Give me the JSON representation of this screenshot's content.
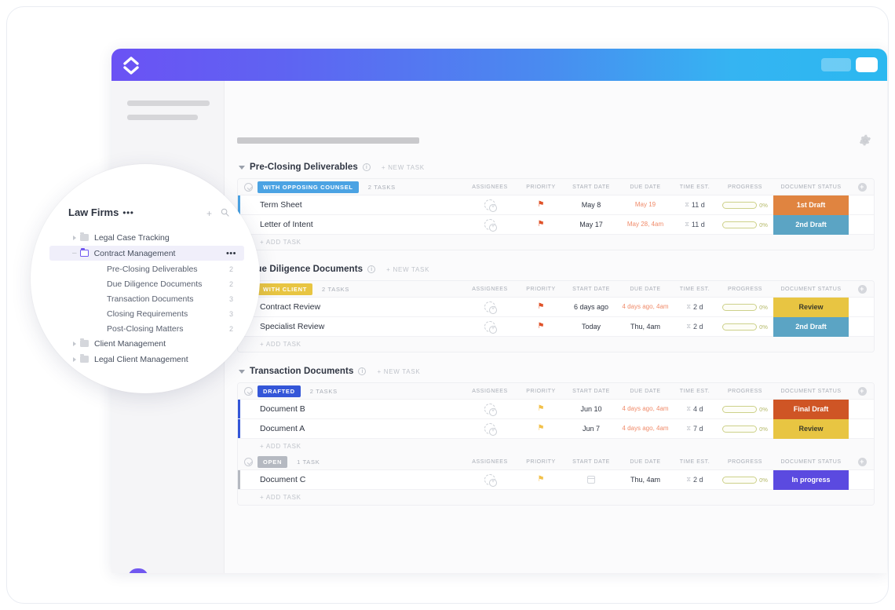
{
  "app": {
    "logo_icon": "clickup-logo-icon",
    "topbar_gradient_from": "#6b52f4",
    "topbar_gradient_to": "#2bb8f0",
    "gear_icon": "gear-icon",
    "chat_icon": "chat-bubble-icon",
    "chat_dots": "•••"
  },
  "columns": {
    "assignees": "ASSIGNEES",
    "priority": "PRIORITY",
    "start_date": "START DATE",
    "due_date": "DUE DATE",
    "time_est": "TIME EST.",
    "progress": "PROGRESS",
    "document_status": "DOCUMENT STATUS",
    "add_column": "+"
  },
  "labels": {
    "new_task": "+ NEW TASK",
    "add_task": "+ ADD TASK",
    "info": "i"
  },
  "groups": [
    {
      "title": "Pre-Closing Deliverables",
      "subgroups": [
        {
          "status_label": "WITH OPPOSING COUNSEL",
          "status_color": "#4ba3e3",
          "task_count": "2 TASKS",
          "tasks": [
            {
              "name": "Term Sheet",
              "priority_color": "#e0532a",
              "start_date": "May 8",
              "due_date": "May 19",
              "due_overdue": true,
              "time_est": "11 d",
              "progress": "0%",
              "doc_status": "1st Draft",
              "doc_status_bg": "#e08440",
              "doc_status_fg": "#ffffff"
            },
            {
              "name": "Letter of Intent",
              "priority_color": "#e0532a",
              "start_date": "May 17",
              "due_date": "May 28, 4am",
              "due_overdue": true,
              "time_est": "11 d",
              "progress": "0%",
              "doc_status": "2nd Draft",
              "doc_status_bg": "#5ba4c4",
              "doc_status_fg": "#ffffff"
            }
          ]
        }
      ]
    },
    {
      "title": "Due Diligence Documents",
      "subgroups": [
        {
          "status_label": "WITH CLIENT",
          "status_color": "#e8c542",
          "task_count": "2 TASKS",
          "tasks": [
            {
              "name": "Contract Review",
              "priority_color": "#e0532a",
              "start_date": "6 days ago",
              "due_date": "4 days ago, 4am",
              "due_overdue": true,
              "time_est": "2 d",
              "progress": "0%",
              "doc_status": "Review",
              "doc_status_bg": "#e8c542",
              "doc_status_fg": "#3a3a2a"
            },
            {
              "name": "Specialist Review",
              "priority_color": "#e0532a",
              "start_date": "Today",
              "due_date": "Thu, 4am",
              "due_overdue": false,
              "time_est": "2 d",
              "progress": "0%",
              "doc_status": "2nd Draft",
              "doc_status_bg": "#5ba4c4",
              "doc_status_fg": "#ffffff"
            }
          ]
        }
      ]
    },
    {
      "title": "Transaction Documents",
      "subgroups": [
        {
          "status_label": "DRAFTED",
          "status_color": "#3456d8",
          "task_count": "2 TASKS",
          "tasks": [
            {
              "name": "Document B",
              "priority_color": "#f2c14b",
              "start_date": "Jun 10",
              "due_date": "4 days ago, 4am",
              "due_overdue": true,
              "time_est": "4 d",
              "progress": "0%",
              "doc_status": "Final Draft",
              "doc_status_bg": "#cf5525",
              "doc_status_fg": "#ffffff"
            },
            {
              "name": "Document A",
              "priority_color": "#f2c14b",
              "start_date": "Jun 7",
              "due_date": "4 days ago, 4am",
              "due_overdue": true,
              "time_est": "7 d",
              "progress": "0%",
              "doc_status": "Review",
              "doc_status_bg": "#e8c542",
              "doc_status_fg": "#3a3a2a"
            }
          ]
        },
        {
          "status_label": "OPEN",
          "status_color": "#b5b9c1",
          "task_count": "1 TASK",
          "tasks": [
            {
              "name": "Document C",
              "priority_color": "#f2c14b",
              "start_date": "",
              "start_is_calendar": true,
              "due_date": "Thu, 4am",
              "due_overdue": false,
              "time_est": "2 d",
              "progress": "0%",
              "doc_status": "In progress",
              "doc_status_bg": "#5b4ae0",
              "doc_status_fg": "#ffffff"
            }
          ]
        }
      ]
    }
  ],
  "lens": {
    "title": "Law Firms",
    "title_dots": "•••",
    "add_label": "+",
    "search_icon": "search-icon",
    "tree": [
      {
        "label": "Legal Case Tracking",
        "type": "folder",
        "indent": "arrow",
        "count": ""
      },
      {
        "label": "Contract Management",
        "type": "folder-open",
        "indent": "dash",
        "count": "",
        "active": true,
        "dots": "•••"
      },
      {
        "label": "Pre-Closing Deliverables",
        "type": "child",
        "count": "2"
      },
      {
        "label": "Due Diligence Documents",
        "type": "child",
        "count": "2"
      },
      {
        "label": "Transaction Documents",
        "type": "child",
        "count": "3"
      },
      {
        "label": "Closing Requirements",
        "type": "child",
        "count": "3"
      },
      {
        "label": "Post-Closing Matters",
        "type": "child",
        "count": "2"
      },
      {
        "label": "Client Management",
        "type": "folder",
        "indent": "arrow",
        "count": ""
      },
      {
        "label": "Legal Client Management",
        "type": "folder",
        "indent": "arrow",
        "count": ""
      }
    ]
  }
}
